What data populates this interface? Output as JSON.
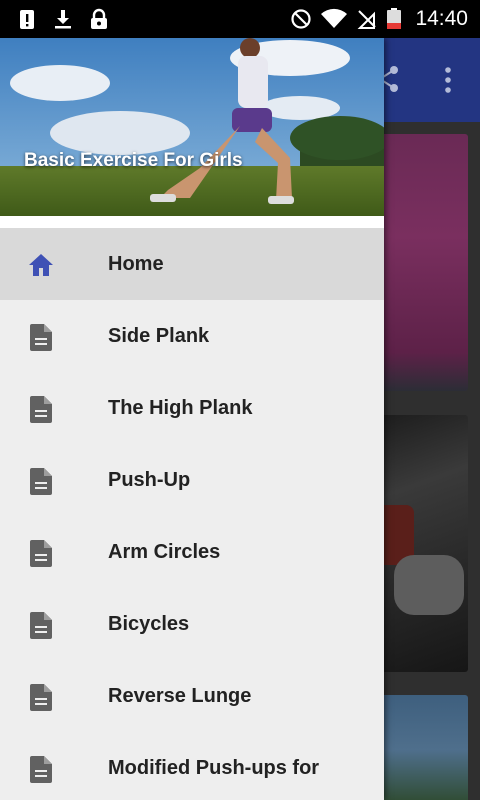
{
  "status_bar": {
    "time": "14:40",
    "left_icons": [
      "alert-icon",
      "download-icon",
      "lock-icon"
    ],
    "right_icons": [
      "do-not-disturb-icon",
      "wifi-icon",
      "no-sim-icon",
      "battery-low-icon"
    ]
  },
  "drawer": {
    "header_title": "Basic Exercise For Girls",
    "items": [
      {
        "label": "Home",
        "icon": "home-icon",
        "active": true
      },
      {
        "label": "Side Plank",
        "icon": "document-icon",
        "active": false
      },
      {
        "label": "The High Plank",
        "icon": "document-icon",
        "active": false
      },
      {
        "label": "Push-Up",
        "icon": "document-icon",
        "active": false
      },
      {
        "label": "Arm Circles",
        "icon": "document-icon",
        "active": false
      },
      {
        "label": "Bicycles",
        "icon": "document-icon",
        "active": false
      },
      {
        "label": "Reverse Lunge",
        "icon": "document-icon",
        "active": false
      },
      {
        "label": "Modified Push-ups for",
        "icon": "document-icon",
        "active": false
      }
    ]
  },
  "background_app": {
    "toolbar_color": "#233582",
    "toolbar_icons": [
      "share-icon",
      "more-vert-icon"
    ]
  },
  "colors": {
    "accent": "#3f51b5",
    "drawer_bg": "#eeeeee",
    "active_item_bg": "#d9d9d9",
    "icon_gray": "#616161"
  }
}
